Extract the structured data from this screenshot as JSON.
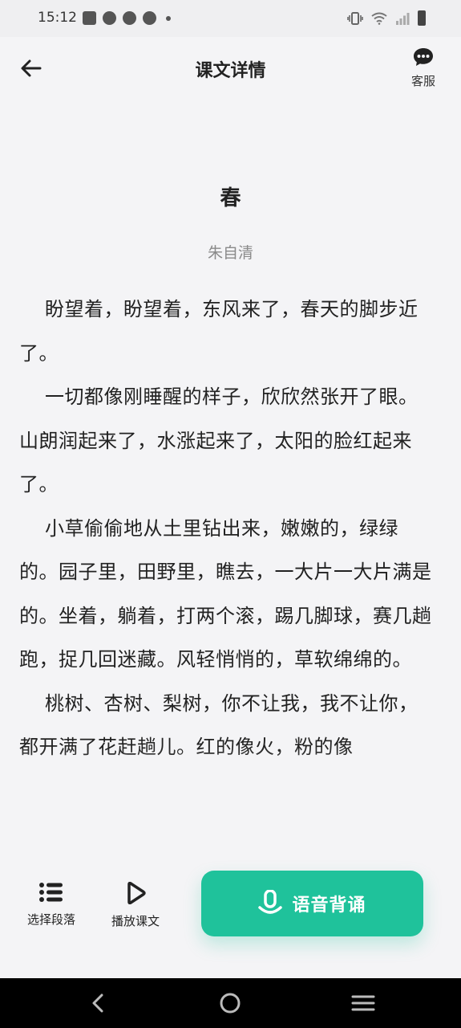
{
  "status_bar": {
    "time": "15:12",
    "icons_left": [
      "notification-square-icon",
      "circle-app-icon",
      "circle-app-icon",
      "circle-app-icon",
      "more-dot-icon"
    ],
    "icons_right": [
      "vibrate-icon",
      "wifi-icon",
      "signal-icon",
      "battery-icon"
    ]
  },
  "header": {
    "title": "课文详情",
    "service_label": "客服"
  },
  "article": {
    "title": "春",
    "author": "朱自清",
    "paragraphs": [
      "盼望着，盼望着，东风来了，春天的脚步近了。",
      "一切都像刚睡醒的样子，欣欣然张开了眼。山朗润起来了，水涨起来了，太阳的脸红起来了。",
      "小草偷偷地从土里钻出来，嫩嫩的，绿绿的。园子里，田野里，瞧去，一大片一大片满是的。坐着，躺着，打两个滚，踢几脚球，赛几趟跑，捉几回迷藏。风轻悄悄的，草软绵绵的。",
      "桃树、杏树、梨树，你不让我，我不让你，都开满了花赶趟儿。红的像火，粉的像"
    ]
  },
  "actions": {
    "select_paragraph": "选择段落",
    "play_text": "播放课文",
    "recite": "语音背诵"
  },
  "colors": {
    "accent": "#1fc29b",
    "background": "#f4f4f6",
    "text": "#222222",
    "muted": "#8a8a8a"
  }
}
